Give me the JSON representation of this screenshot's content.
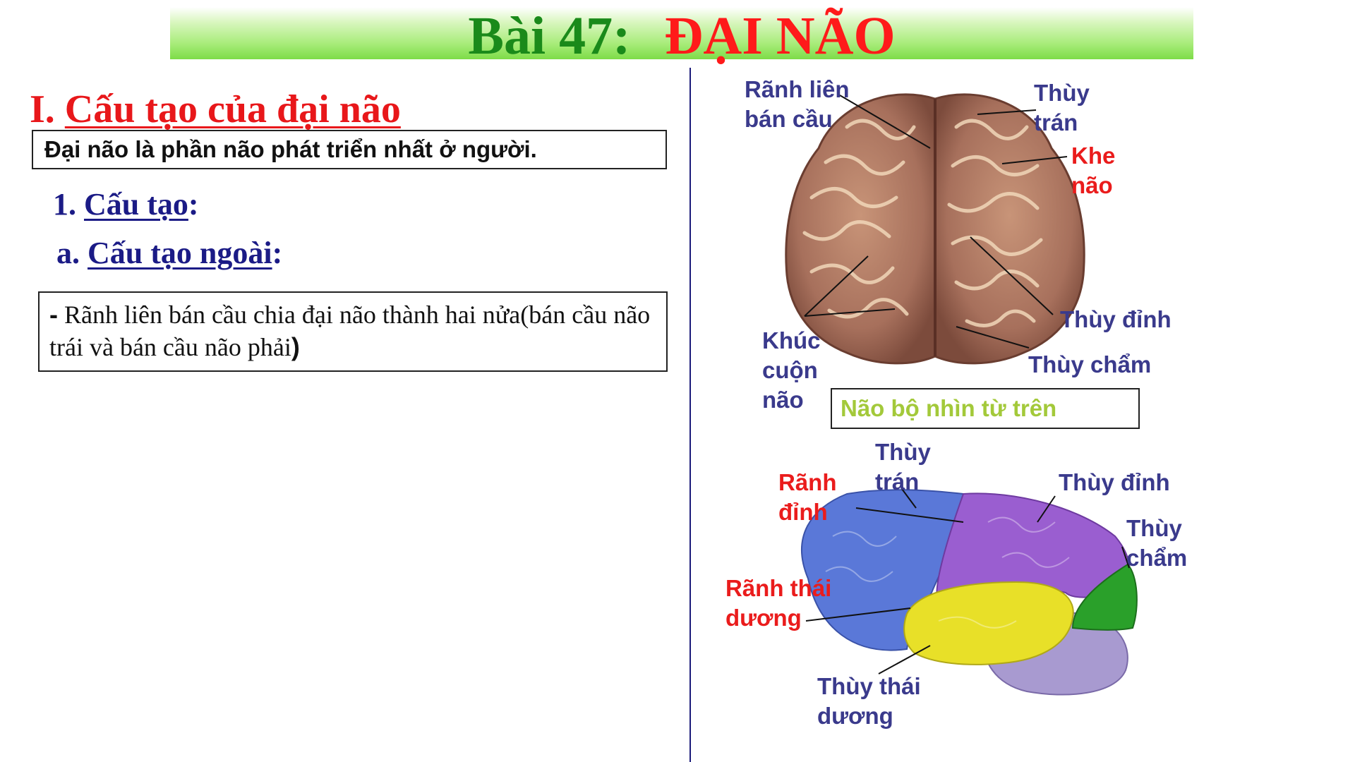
{
  "title": {
    "prefix": "Bài 47:",
    "main": "ĐẠI NÃO"
  },
  "section": {
    "number": "I.",
    "heading": "Cấu tạo của đại não"
  },
  "definition": "Đại não là phần não phát triển nhất ở người.",
  "subheading1": {
    "number": "1.",
    "text": "Cấu tạo",
    "suffix": ":"
  },
  "subheading2": {
    "number": "a.",
    "text": "Cấu tạo ngoài",
    "suffix": ":"
  },
  "point1": {
    "dash": "-",
    "text": " Rãnh liên bán cầu chia đại não thành hai nửa(bán cầu não trái và bán cầu não phải",
    "close": ")"
  },
  "top_view": {
    "labels": {
      "ranh_lien_ban_cau_1": "Rãnh liên",
      "ranh_lien_ban_cau_2": "bán cầu",
      "thuy_tran_1": "Thùy",
      "thuy_tran_2": "trán",
      "khe_nao_1": "Khe",
      "khe_nao_2": "não",
      "thuy_dinh": "Thùy đỉnh",
      "thuy_cham": "Thùy chẩm",
      "khuc_cuon_nao_1": "Khúc",
      "khuc_cuon_nao_2": "cuộn",
      "khuc_cuon_nao_3": "não"
    },
    "caption": "Não bộ nhìn từ trên"
  },
  "side_view": {
    "labels": {
      "thuy_tran_1": "Thùy",
      "thuy_tran_2": "trán",
      "ranh_dinh_1": "Rãnh",
      "ranh_dinh_2": "đỉnh",
      "thuy_dinh": "Thùy đỉnh",
      "thuy_cham_1": "Thùy",
      "thuy_cham_2": "chẩm",
      "ranh_thai_duong_1": "Rãnh thái",
      "ranh_thai_duong_2": "dương",
      "thuy_thai_duong_1": "Thùy thái",
      "thuy_thai_duong_2": "dương"
    }
  },
  "colors": {
    "title_green": "#1a8a1a",
    "title_red": "#ff1a1a",
    "heading_red": "#e8171a",
    "navy": "#1b1b86",
    "label_navy": "#3a3a8c",
    "label_red": "#ea1c1c",
    "caption_green": "#a3c93a",
    "frontal_lobe": "#5a78d8",
    "parietal_lobe": "#9a5ed0",
    "temporal_lobe": "#e8e028",
    "occipital_lobe": "#2aa02a",
    "cerebellum": "#a89ad0",
    "brain_top": "#a7705c"
  }
}
